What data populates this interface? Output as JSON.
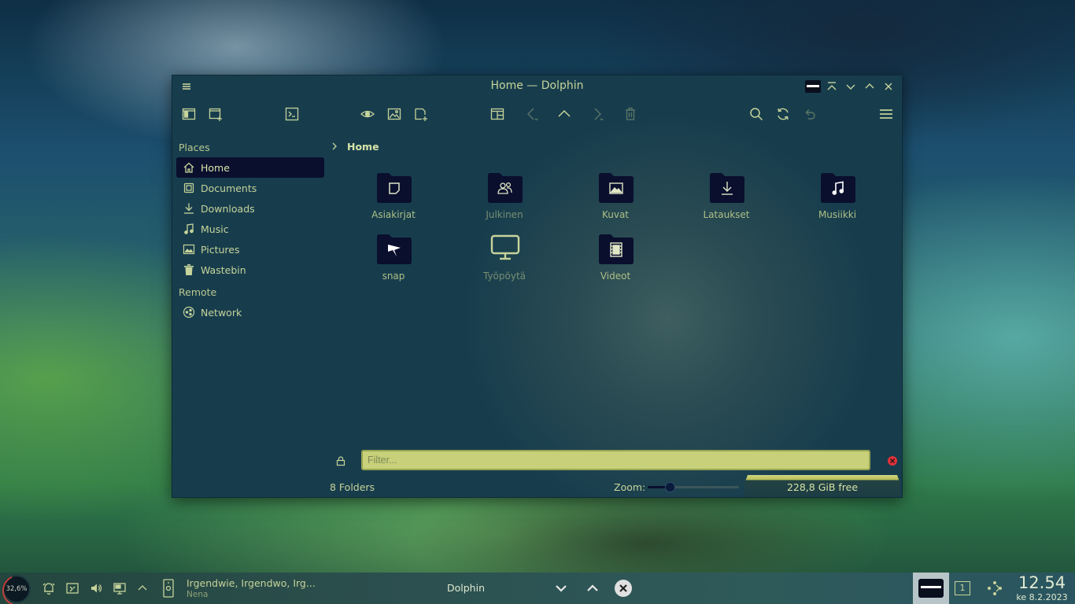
{
  "window": {
    "title": "Home — Dolphin"
  },
  "sidebar": {
    "places_header": "Places",
    "places": [
      {
        "label": "Home",
        "icon": "home-icon",
        "active": true
      },
      {
        "label": "Documents",
        "icon": "documents-icon"
      },
      {
        "label": "Downloads",
        "icon": "downloads-icon"
      },
      {
        "label": "Music",
        "icon": "music-icon"
      },
      {
        "label": "Pictures",
        "icon": "pictures-icon"
      },
      {
        "label": "Wastebin",
        "icon": "trash-icon"
      }
    ],
    "remote_header": "Remote",
    "remote": [
      {
        "label": "Network",
        "icon": "network-icon"
      }
    ]
  },
  "breadcrumb": {
    "current": "Home"
  },
  "folders": [
    {
      "label": "Asiakirjat",
      "icon": "document-folder-icon"
    },
    {
      "label": "Julkinen",
      "icon": "public-folder-icon"
    },
    {
      "label": "Kuvat",
      "icon": "pictures-folder-icon"
    },
    {
      "label": "Lataukset",
      "icon": "downloads-folder-icon"
    },
    {
      "label": "Musiikki",
      "icon": "music-folder-icon"
    },
    {
      "label": "snap",
      "icon": "snap-folder-icon"
    },
    {
      "label": "Työpöytä",
      "icon": "desktop-monitor-icon"
    },
    {
      "label": "Videot",
      "icon": "videos-folder-icon"
    }
  ],
  "filter": {
    "placeholder": "Filter..."
  },
  "status": {
    "summary": "8 Folders",
    "zoom_label": "Zoom:",
    "zoom_fraction": 0.24,
    "free_space": "228,8 GiB free"
  },
  "taskbar": {
    "cpu_load": "32,6%",
    "media_title": "Irgendwie, Irgendwo, Irg...",
    "media_artist": "Nena",
    "task_label": "Dolphin",
    "desktop_number": "1",
    "clock_time": "12.54",
    "clock_date": "ke 8.2.2023"
  },
  "colors": {
    "accent_text": "#c6d39a",
    "active_place_bg": "#0a0f2e",
    "filter_bg": "#c8d07a",
    "folder_icon": "#0a0f2e"
  }
}
